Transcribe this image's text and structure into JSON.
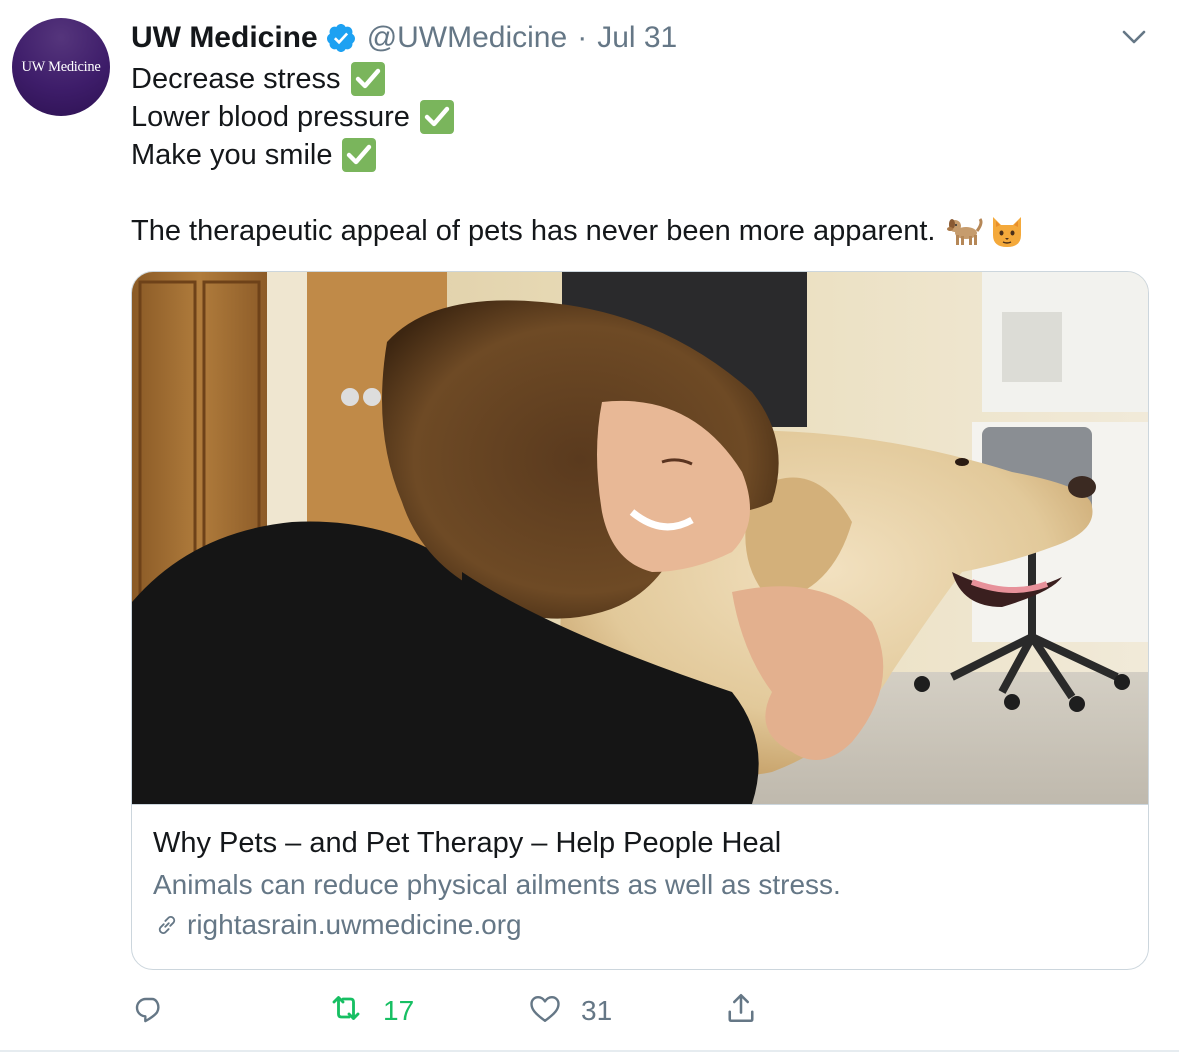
{
  "author": {
    "avatar_text": "UW Medicine",
    "display_name": "UW Medicine",
    "verified": true,
    "handle": "@UWMedicine",
    "separator": "·",
    "date": "Jul 31"
  },
  "tweet": {
    "lines": [
      "Decrease stress",
      "Lower blood pressure",
      "Make you smile"
    ],
    "check_icon": "white-heavy-check-mark",
    "closing_line": "The therapeutic appeal of pets has never been more apparent.",
    "emojis": [
      "dog-emoji",
      "cat-face-emoji"
    ]
  },
  "card": {
    "image": "woman hugging a yellow labrador retriever in a clinic room",
    "title": "Why Pets – and Pet Therapy – Help People Heal",
    "description": "Animals can reduce physical ailments as well as stress.",
    "domain": "rightasrain.uwmedicine.org"
  },
  "actions": {
    "reply_count": "",
    "retweet_count": "17",
    "like_count": "31",
    "retweet_color": "#17bf63",
    "muted_color": "#657786"
  },
  "colors": {
    "verified_blue": "#1da1f2",
    "avatar_purple": "#3e1d6a",
    "check_green": "#7ab55c",
    "border": "#ccd6dd"
  }
}
